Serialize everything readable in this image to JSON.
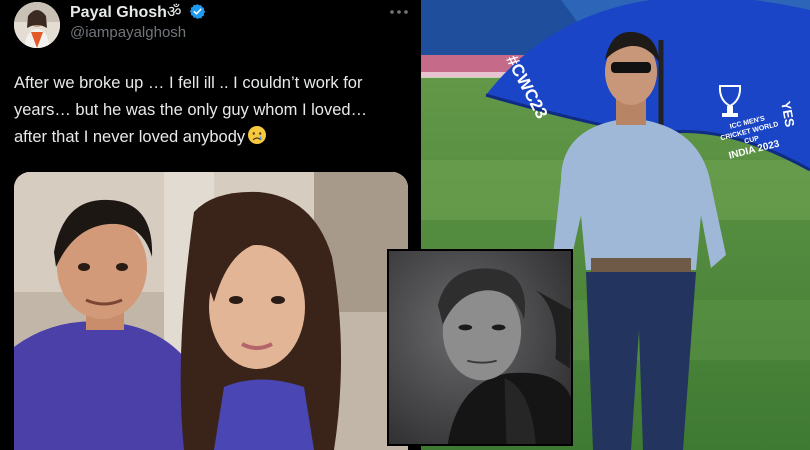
{
  "tweet": {
    "author_name": "Payal Ghosh",
    "author_name_suffix": "ॐ",
    "handle": "@iampayalghosh",
    "text_lines": [
      "After we broke up … I fell ill .. I couldn’t work for",
      "years… but he was the only guy whom I loved…",
      "after that I never loved anybody"
    ],
    "emoji": "crying-face-emoji",
    "colors": {
      "text": "#e7e9ea",
      "secondary": "#71767b",
      "verified": "#1d9bf0",
      "background": "#000000"
    }
  },
  "right_photo": {
    "umbrella_lines": [
      "#CWC23",
      "ICC MEN'S",
      "CRICKET WORLD CUP",
      "INDIA 2023",
      "YES"
    ]
  }
}
